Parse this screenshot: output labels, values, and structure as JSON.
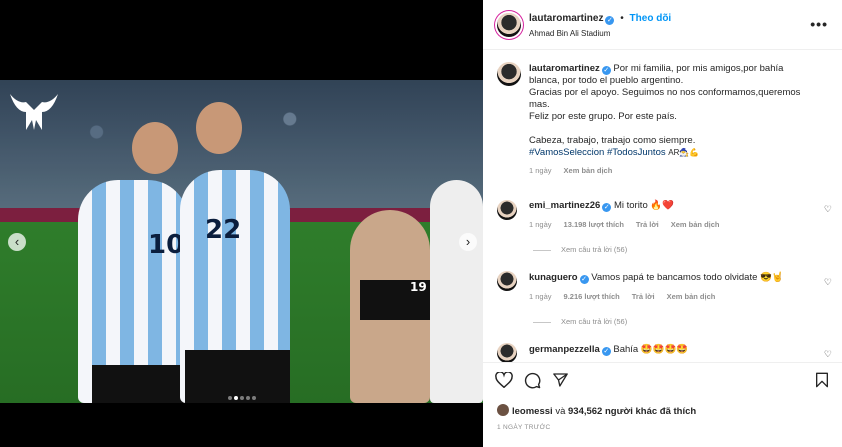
{
  "post": {
    "author": "lautaromartinez",
    "follow_label": "Theo dõi",
    "location": "Ahmad Bin Ali Stadium",
    "more_label": "•••",
    "caption": {
      "username": "lautaromartinez",
      "lines": [
        "Por mi familia, por mis amigos,por bahía",
        "blanca, por todo el pueblo argentino.",
        "Gracias por el apoyo. Seguimos no nos conformamos,queremos",
        "mas.",
        "Feliz por este grupo. Por este país.",
        "",
        "Cabeza, trabajo, trabajo como siempre."
      ],
      "hashtags": "#VamosSeleccion #TodosJuntos",
      "suffix": "AR🧙‍♂️💪",
      "age": "1 ngày",
      "translate": "Xem bản dịch"
    },
    "comments": [
      {
        "username": "emi_martinez26",
        "text": "Mi torito 🔥❤️",
        "age": "1 ngày",
        "likes": "13.198 lượt thích",
        "reply": "Trả lời",
        "translate": "Xem bản dịch",
        "view_replies": "Xem câu trả lời (56)"
      },
      {
        "username": "kunaguero",
        "text": "Vamos papá te bancamos todo olvidate 😎🤘",
        "age": "1 ngày",
        "likes": "9.216 lượt thích",
        "reply": "Trả lời",
        "translate": "Xem bản dịch",
        "view_replies": "Xem câu trả lời (56)"
      },
      {
        "username": "germanpezzella",
        "text": "Bahía 🤩🤩🤩🤩"
      }
    ],
    "likes_summary": {
      "user": "leomessi",
      "connector": "và",
      "count": "934,562",
      "rest": "người khác đã thích"
    },
    "date": "1 NGÀY TRƯỚC"
  },
  "photo": {
    "jersey_numbers": [
      "10",
      "22",
      "19"
    ],
    "watermark": "M",
    "carousel_prev": "‹",
    "carousel_next": "›",
    "dots_count": 5,
    "active_dot": 1
  },
  "icons": {
    "verified": "✓",
    "heart": "♡",
    "comment": "◯",
    "share": "➢",
    "save": "🔖"
  },
  "colors": {
    "follow": "#0095f6",
    "hashtag": "#00376b",
    "verified": "#3897f0"
  }
}
